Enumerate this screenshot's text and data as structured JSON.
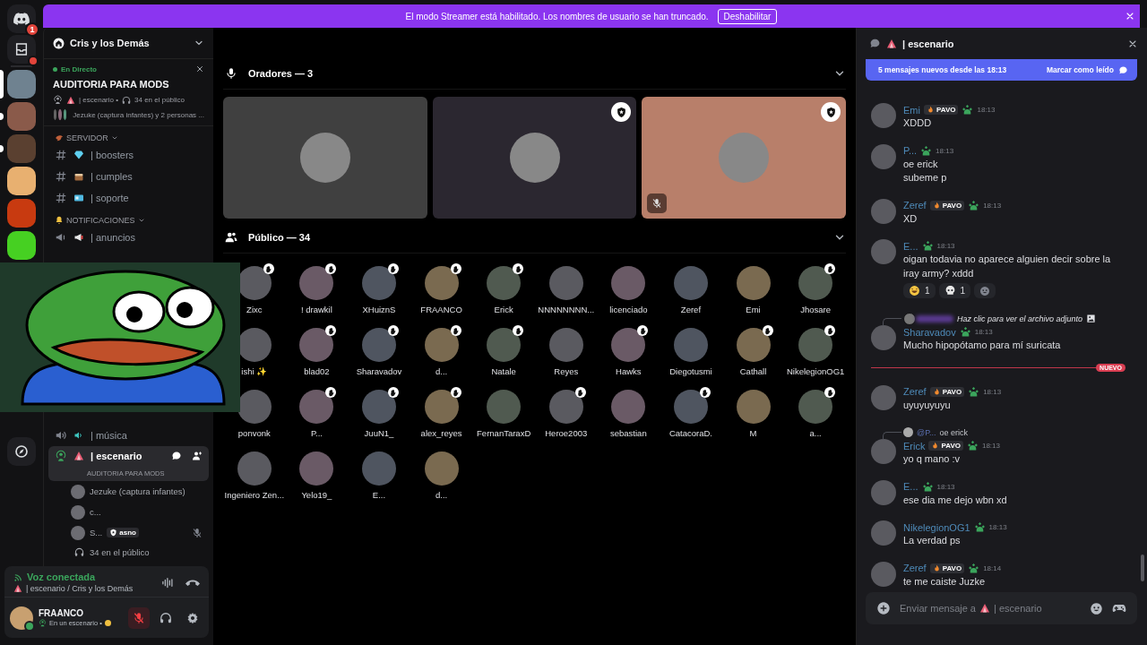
{
  "rail": {
    "home_badge": "1",
    "inbox_unread": true,
    "servers": [
      {
        "selected": true,
        "unread": false,
        "color": "#6f8290"
      },
      {
        "selected": false,
        "unread": true,
        "color": "#8a5a4a"
      },
      {
        "selected": false,
        "unread": true,
        "color": "#5a4030"
      },
      {
        "selected": false,
        "unread": false,
        "color": "#e8b070"
      },
      {
        "selected": false,
        "unread": false,
        "color": "#c83a10"
      },
      {
        "selected": false,
        "unread": false,
        "color": "#46d022"
      }
    ]
  },
  "banner": {
    "text": "El modo Streamer está habilitado. Los nombres de usuario se han truncado.",
    "button": "Deshabilitar"
  },
  "sidebar": {
    "server_name": "Cris y los Demás",
    "live": {
      "label": "En Directo",
      "title": "AUDITORIA PARA MODS",
      "channel": "| escenario •",
      "audience": "34 en el público",
      "participants": "Jezuke (captura infantes) y 2 personas ..."
    },
    "categories": [
      {
        "name": "SERVIDOR",
        "channels": [
          {
            "kind": "text",
            "name": "| boosters"
          },
          {
            "kind": "text",
            "name": "| cumples"
          },
          {
            "kind": "text",
            "name": "| soporte"
          }
        ]
      },
      {
        "name": "NOTIFICACIONES",
        "channels": [
          {
            "kind": "announcement",
            "name": "| anuncios"
          }
        ]
      }
    ],
    "voice_channels": [
      {
        "kind": "voice",
        "name": "| música",
        "selected": false
      },
      {
        "kind": "stage",
        "name": "| escenario",
        "selected": true,
        "topic": "AUDITORIA PARA MODS",
        "members": [
          {
            "name": "Jezuke (captura infantes)",
            "muted": false
          },
          {
            "name": "c...",
            "muted": false
          },
          {
            "name": "S...",
            "tag": "asno",
            "muted": true
          }
        ],
        "audience": "34 en el público"
      }
    ]
  },
  "voice_panel": {
    "status": "Voz conectada",
    "location": "| escenario / Cris y los Demás"
  },
  "user_panel": {
    "name": "FRAANCO",
    "status": "En un escenario •",
    "mic_muted": true
  },
  "stage": {
    "speakers_header": "Oradores — 3",
    "speakers": [
      {
        "color": "#404040",
        "moderator": false,
        "muted": false
      },
      {
        "color": "#2b2730",
        "moderator": true,
        "muted": false
      },
      {
        "color": "#b87f6a",
        "moderator": true,
        "muted": true
      }
    ],
    "audience_header": "Público — 34",
    "audience": [
      {
        "name": "Zixc",
        "hand_raised": true
      },
      {
        "name": "! drawkil",
        "hand_raised": true
      },
      {
        "name": "XHuiznS",
        "hand_raised": true
      },
      {
        "name": "FRAANCO",
        "hand_raised": true
      },
      {
        "name": "Erick",
        "hand_raised": true
      },
      {
        "name": "NNNNNNNN...",
        "hand_raised": false
      },
      {
        "name": "licenciado",
        "hand_raised": false
      },
      {
        "name": "Zeref",
        "hand_raised": false
      },
      {
        "name": "Emi",
        "hand_raised": false
      },
      {
        "name": "Jhosare",
        "hand_raised": true
      },
      {
        "name": "ishi ✨",
        "hand_raised": false
      },
      {
        "name": "blad02",
        "hand_raised": true
      },
      {
        "name": "Sharavadov",
        "hand_raised": true
      },
      {
        "name": "d...",
        "hand_raised": true
      },
      {
        "name": "Natale",
        "hand_raised": true
      },
      {
        "name": "Reyes",
        "hand_raised": false
      },
      {
        "name": "Hawks",
        "hand_raised": true
      },
      {
        "name": "Diegotusmi",
        "hand_raised": false
      },
      {
        "name": "Cathall",
        "hand_raised": true
      },
      {
        "name": "NikelegionOG1",
        "hand_raised": true
      },
      {
        "name": "ponvonk",
        "hand_raised": false
      },
      {
        "name": "P...",
        "hand_raised": true
      },
      {
        "name": "JuuN1_",
        "hand_raised": true
      },
      {
        "name": "alex_reyes",
        "hand_raised": true
      },
      {
        "name": "FernanTaraxD",
        "hand_raised": false
      },
      {
        "name": "Heroe2003",
        "hand_raised": true
      },
      {
        "name": "sebastian",
        "hand_raised": false
      },
      {
        "name": "CatacoraD.",
        "hand_raised": true
      },
      {
        "name": "M",
        "hand_raised": false
      },
      {
        "name": "a...",
        "hand_raised": true
      },
      {
        "name": "Ingeniero Zen...",
        "hand_raised": false
      },
      {
        "name": "Yelo19_",
        "hand_raised": false
      },
      {
        "name": "E...",
        "hand_raised": false
      },
      {
        "name": "d...",
        "hand_raised": false
      }
    ]
  },
  "chat": {
    "channel": "| escenario",
    "new_messages": {
      "text": "5 mensajes nuevos desde las 18:13",
      "action": "Marcar como leído"
    },
    "messages": [
      {
        "kind": "message",
        "author": "Emi",
        "badge": "PAVO",
        "time": "18:13",
        "lines": [
          "XDDD"
        ]
      },
      {
        "kind": "message",
        "author": "P...",
        "time": "18:13",
        "lines": [
          "oe erick",
          "subeme p"
        ]
      },
      {
        "kind": "message",
        "author": "Zeref",
        "badge": "PAVO",
        "time": "18:13",
        "lines": [
          "XD"
        ]
      },
      {
        "kind": "message",
        "author": "E...",
        "time": "18:13",
        "lines": [
          "oigan todavia no aparece alguien decir sobre la iray army? xddd"
        ],
        "reactions": [
          {
            "kind": "laugh",
            "count": "1"
          },
          {
            "kind": "skull",
            "count": "1"
          }
        ]
      },
      {
        "kind": "message",
        "author": "Sharavadov",
        "time": "18:13",
        "lines": [
          "Mucho hipopótamo para mí suricata"
        ],
        "reply": {
          "mention_hidden": true,
          "text": "Haz clic para ver el archivo adjunto",
          "attachment": true
        }
      },
      {
        "kind": "divider",
        "label": "NUEVO"
      },
      {
        "kind": "message",
        "author": "Zeref",
        "badge": "PAVO",
        "time": "18:13",
        "lines": [
          "uyuyuyuyu"
        ]
      },
      {
        "kind": "message",
        "author": "Erick",
        "badge": "PAVO",
        "time": "18:13",
        "lines": [
          "yo q mano :v"
        ],
        "reply": {
          "mention_hidden": false,
          "mention": "@P...",
          "text": "oe erick",
          "attachment": false
        }
      },
      {
        "kind": "message",
        "author": "E...",
        "time": "18:13",
        "lines": [
          "ese dia me dejo wbn xd"
        ]
      },
      {
        "kind": "message",
        "author": "NikelegionOG1",
        "time": "18:13",
        "lines": [
          "La verdad ps"
        ]
      },
      {
        "kind": "message",
        "author": "Zeref",
        "badge": "PAVO",
        "time": "18:14",
        "lines": [
          "te me caiste Juzke"
        ]
      }
    ],
    "input": {
      "placeholder": "Enviar mensaje a",
      "channel": "| escenario"
    }
  }
}
